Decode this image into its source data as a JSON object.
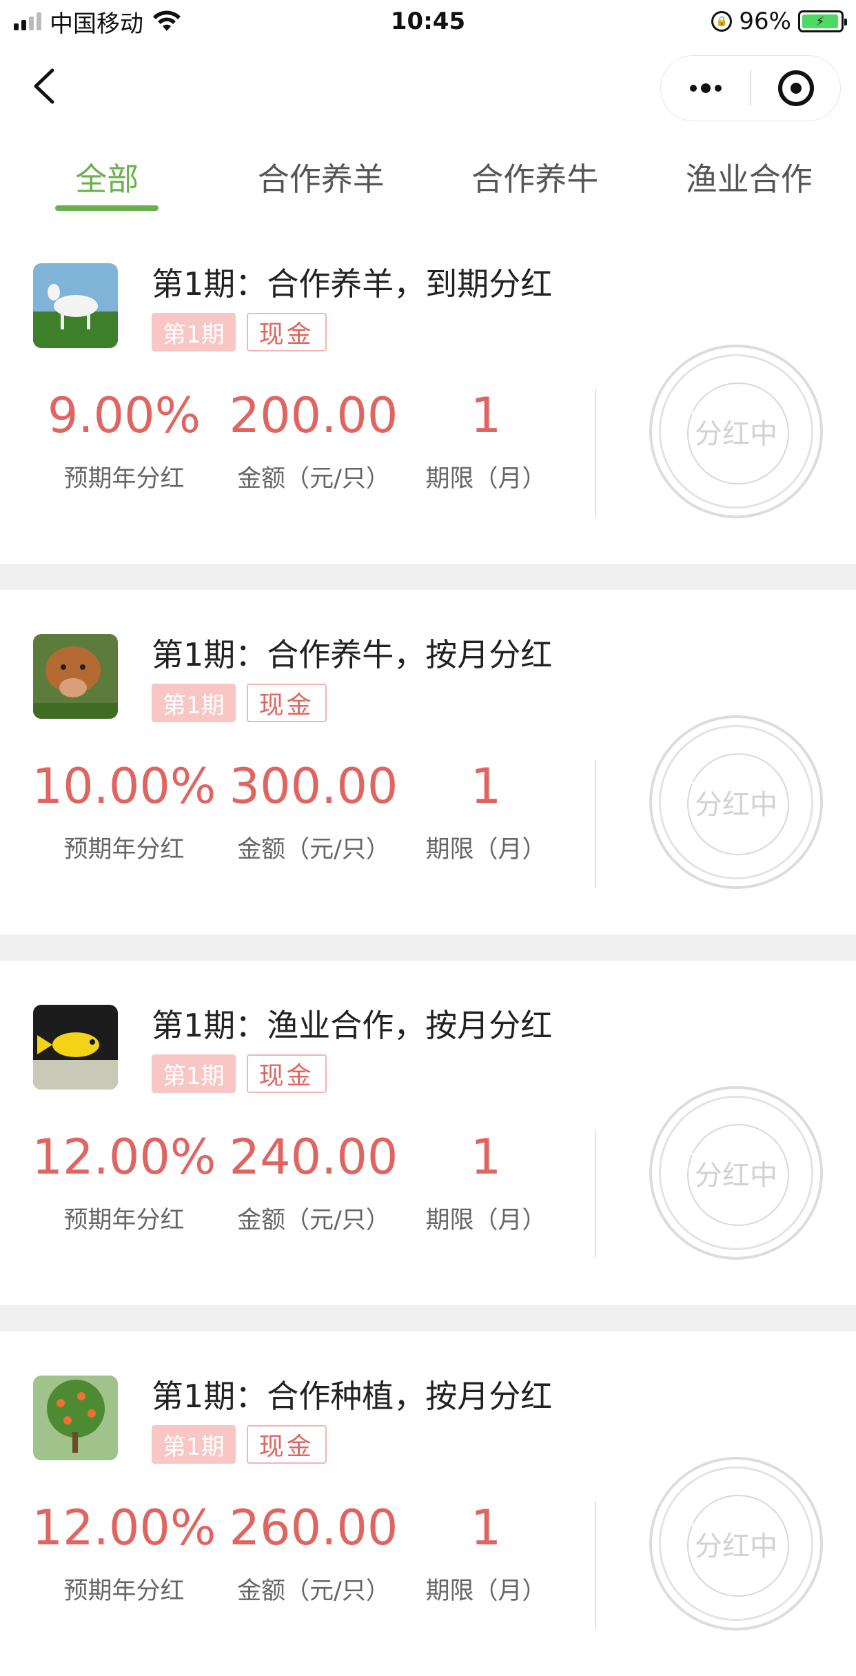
{
  "status_bar": {
    "carrier": "中国移动",
    "time": "10:45",
    "battery": "96%"
  },
  "nav": {
    "back_icon": "chevron-left-icon",
    "more_icon": "more-dots-icon",
    "close_icon": "target-icon"
  },
  "tabs": [
    {
      "label": "全部",
      "active": true
    },
    {
      "label": "合作养羊",
      "active": false
    },
    {
      "label": "合作养牛",
      "active": false
    },
    {
      "label": "渔业合作",
      "active": false
    }
  ],
  "items": [
    {
      "title": "第1期：合作养羊，到期分红",
      "tag_period": "第1期",
      "tag_cash": "现金",
      "rate": "9.00%",
      "amount": "200.00",
      "term": "1",
      "rate_label": "预期年分红",
      "amount_label": "金额（元/只）",
      "term_label": "期限（月）",
      "status": "分红中",
      "thumb": "goat"
    },
    {
      "title": "第1期：合作养牛，按月分红",
      "tag_period": "第1期",
      "tag_cash": "现金",
      "rate": "10.00%",
      "amount": "300.00",
      "term": "1",
      "rate_label": "预期年分红",
      "amount_label": "金额（元/只）",
      "term_label": "期限（月）",
      "status": "分红中",
      "thumb": "cow"
    },
    {
      "title": "第1期：渔业合作，按月分红",
      "tag_period": "第1期",
      "tag_cash": "现金",
      "rate": "12.00%",
      "amount": "240.00",
      "term": "1",
      "rate_label": "预期年分红",
      "amount_label": "金额（元/只）",
      "term_label": "期限（月）",
      "status": "分红中",
      "thumb": "fish"
    },
    {
      "title": "第1期：合作种植，按月分红",
      "tag_period": "第1期",
      "tag_cash": "现金",
      "rate": "12.00%",
      "amount": "260.00",
      "term": "1",
      "rate_label": "预期年分红",
      "amount_label": "金额（元/只）",
      "term_label": "期限（月）",
      "status": "分红中",
      "thumb": "tree"
    }
  ],
  "colors": {
    "accent_green": "#6ab04c",
    "value_red": "#e06560",
    "tag_pink": "#f8c7c5"
  }
}
